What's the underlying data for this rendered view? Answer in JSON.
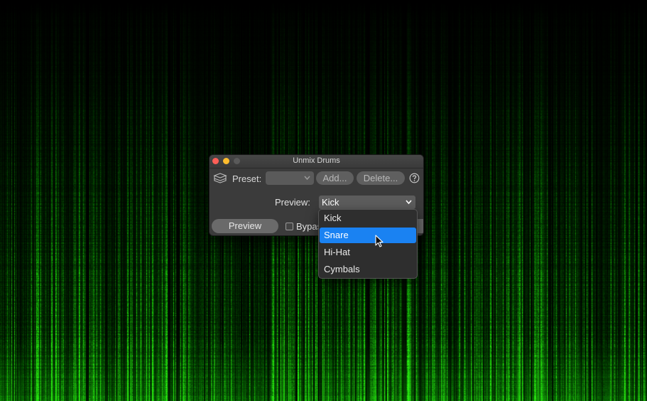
{
  "window": {
    "title": "Unmix Drums",
    "preset_label": "Preset:",
    "preset_value": "",
    "add_label": "Add...",
    "delete_label": "Delete...",
    "preview_label": "Preview:",
    "preview_value": "Kick",
    "preview_button": "Preview",
    "bypass_label": "Bypass",
    "bypass_checked": false
  },
  "dropdown": {
    "options": [
      "Kick",
      "Snare",
      "Hi-Hat",
      "Cymbals"
    ],
    "highlighted": "Snare"
  },
  "colors": {
    "spectrogram": "#1fd71f",
    "highlight": "#1a82f2"
  },
  "icons": {
    "preset": "preset-stack-icon",
    "help": "help-icon",
    "cursor": "mouse-pointer-icon"
  }
}
